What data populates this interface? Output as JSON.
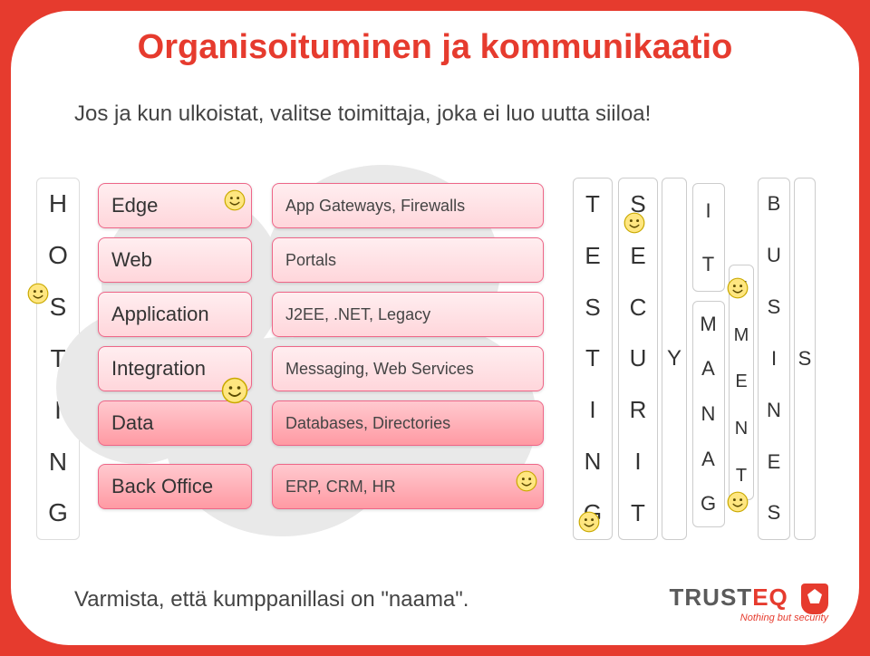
{
  "title": "Organisoituminen ja kommunikaatio",
  "subline": "Jos ja kun ulkoistat, valitse toimittaja, joka ei luo uutta siiloa!",
  "bottomline": "Varmista, että kumppanillasi on \"naama\".",
  "hosting_letters": [
    "H",
    "O",
    "S",
    "T",
    "I",
    "N",
    "G"
  ],
  "layers": [
    {
      "name": "Edge",
      "detail": "App Gateways, Firewalls"
    },
    {
      "name": "Web",
      "detail": "Portals"
    },
    {
      "name": "Application",
      "detail": "J2EE, .NET, Legacy"
    },
    {
      "name": "Integration",
      "detail": "Messaging, Web Services"
    },
    {
      "name": "Data",
      "detail": "Databases, Directories"
    },
    {
      "name": "Back Office",
      "detail": "ERP, CRM, HR"
    }
  ],
  "columns": {
    "testing": [
      "T",
      "E",
      "S",
      "T",
      "I",
      "N",
      "G"
    ],
    "security": [
      "S",
      "E",
      "C",
      "U",
      "R",
      "I",
      "T"
    ],
    "y": "Y",
    "it": [
      "I",
      "T"
    ],
    "mgmt": [
      "M",
      "A",
      "N",
      "A",
      "G"
    ],
    "ement": [
      "E",
      "M",
      "E",
      "N",
      "T"
    ],
    "business": [
      "B",
      "U",
      "S",
      "I",
      "N",
      "E",
      "S"
    ],
    "s": "S"
  },
  "logo": {
    "brand_left": "TRUST",
    "brand_right": "EQ",
    "tag": "Nothing but security"
  }
}
